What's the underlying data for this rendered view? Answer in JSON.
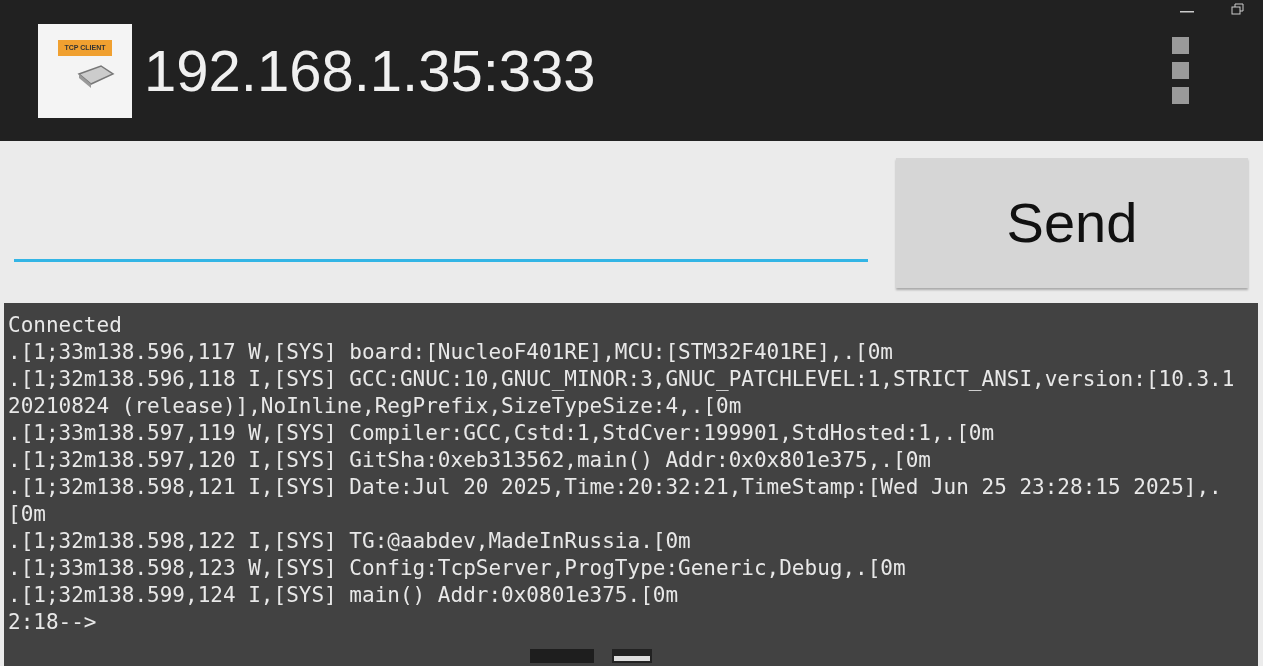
{
  "app_bar": {
    "logo_text": "TCP CLIENT",
    "title": "192.168.1.35:333"
  },
  "send_button": {
    "label": "Send"
  },
  "log_lines": [
    "Connected",
    ".[1;33m138.596,117 W,[SYS] board:[NucleoF401RE],MCU:[STM32F401RE],.[0m",
    ".[1;32m138.596,118 I,[SYS] GCC:GNUC:10,GNUC_MINOR:3,GNUC_PATCHLEVEL:1,STRICT_ANSI,version:[10.3.1",
    "20210824 (release)],NoInline,RegPrefix,SizeTypeSize:4,.[0m",
    ".[1;33m138.597,119 W,[SYS] Compiler:GCC,Cstd:1,StdCver:199901,StdHosted:1,.[0m",
    ".[1;32m138.597,120 I,[SYS] GitSha:0xeb313562,main() Addr:0x0x801e375,.[0m",
    ".[1;32m138.598,121 I,[SYS] Date:Jul 20 2025,Time:20:32:21,TimeStamp:[Wed Jun 25 23:28:15 2025],.",
    "[0m",
    ".[1;32m138.598,122 I,[SYS] TG:@aabdev,MadeInRussia.[0m",
    ".[1;33m138.598,123 W,[SYS] Config:TcpServer,ProgType:Generic,Debug,.[0m",
    ".[1;32m138.599,124 I,[SYS] main() Addr:0x0801e375.[0m",
    "2:18-->"
  ]
}
